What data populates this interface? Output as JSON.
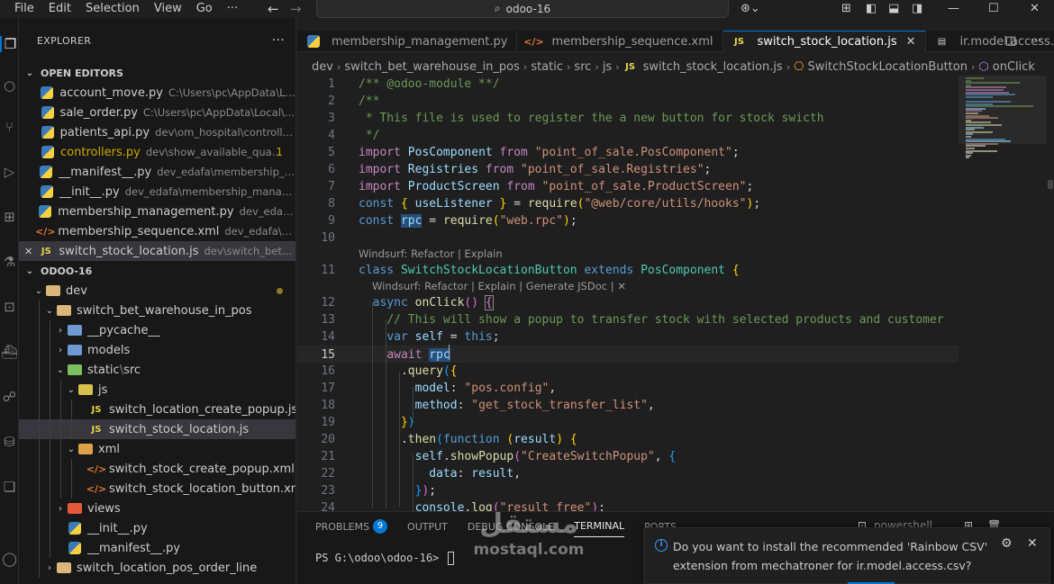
{
  "menu": [
    "File",
    "Edit",
    "Selection",
    "View",
    "Go",
    "···"
  ],
  "command_center": {
    "text": "odoo-16"
  },
  "explorer": {
    "title": "EXPLORER",
    "more": "···",
    "open_editors": {
      "title": "OPEN EDITORS",
      "items": [
        {
          "close": "",
          "icon": "python-file-icon",
          "name": "account_move.py",
          "desc": "C:\\Users\\pc\\AppData\\Lo..."
        },
        {
          "close": "",
          "icon": "python-file-icon",
          "name": "sale_order.py",
          "desc": "C:\\Users\\pc\\AppData\\Local\\T..."
        },
        {
          "close": "",
          "icon": "python-file-icon",
          "name": "patients_api.py",
          "desc": "dev\\om_hospital\\controllers"
        },
        {
          "close": "",
          "icon": "python-file-icon",
          "name": "controllers.py",
          "desc": "dev\\show_available_qua...",
          "badge": "1"
        },
        {
          "close": "",
          "icon": "python-file-icon",
          "name": "__manifest__.py",
          "desc": "dev_edafa\\membership_ma..."
        },
        {
          "close": "",
          "icon": "python-file-icon",
          "name": "__init__.py",
          "desc": "dev_edafa\\membership_manage..."
        },
        {
          "close": "",
          "icon": "python-file-icon",
          "name": "membership_management.py",
          "desc": "dev_edafa\\..."
        },
        {
          "close": "",
          "icon": "xml-file-icon",
          "name": "membership_sequence.xml",
          "desc": "dev_edafa\\me..."
        },
        {
          "close": "✕",
          "icon": "js-file-icon",
          "name": "switch_stock_location.js",
          "desc": "dev\\switch_bet_w..."
        }
      ]
    },
    "workspace": {
      "title": "ODOO-16",
      "tree": [
        {
          "depth": 1,
          "chev": "⌄",
          "icon": "folder",
          "name": "dev",
          "dot": true
        },
        {
          "depth": 2,
          "chev": "⌄",
          "icon": "folder",
          "name": "switch_bet_warehouse_in_pos"
        },
        {
          "depth": 3,
          "chev": "›",
          "icon": "folder-blue",
          "name": "__pycache__"
        },
        {
          "depth": 3,
          "chev": "›",
          "icon": "folder-blue",
          "name": "models"
        },
        {
          "depth": 3,
          "chev": "⌄",
          "icon": "folder-green",
          "name": "static",
          "name2": "src"
        },
        {
          "depth": 4,
          "chev": "⌄",
          "icon": "folder-js",
          "name": "js"
        },
        {
          "depth": 5,
          "chev": "",
          "icon": "js",
          "name": "switch_location_create_popup.js"
        },
        {
          "depth": 5,
          "chev": "",
          "icon": "js",
          "name": "switch_stock_location.js",
          "selected": true
        },
        {
          "depth": 4,
          "chev": "⌄",
          "icon": "folder-xml",
          "name": "xml"
        },
        {
          "depth": 5,
          "chev": "",
          "icon": "xml",
          "name": "switch_stock_create_popup.xml"
        },
        {
          "depth": 5,
          "chev": "",
          "icon": "xml",
          "name": "switch_stock_location_button.xml"
        },
        {
          "depth": 3,
          "chev": "›",
          "icon": "folder-views",
          "name": "views"
        },
        {
          "depth": 3,
          "chev": "",
          "icon": "python",
          "name": "__init__.py"
        },
        {
          "depth": 3,
          "chev": "",
          "icon": "python",
          "name": "__manifest__.py"
        },
        {
          "depth": 2,
          "chev": "›",
          "icon": "folder",
          "name": "switch_location_pos_order_line"
        }
      ]
    }
  },
  "tabs": [
    {
      "icon": "python-file-icon",
      "glyph": "",
      "label": "membership_management.py",
      "active": false
    },
    {
      "icon": "xml-file-icon",
      "glyph": "</>",
      "label": "membership_sequence.xml",
      "active": false
    },
    {
      "icon": "js-file-icon",
      "glyph": "JS",
      "label": "switch_stock_location.js",
      "active": true,
      "close": "✕"
    },
    {
      "icon": "csv-file-icon",
      "glyph": "",
      "label": "ir.model.access.csv",
      "desc": "...\\",
      "active": false
    }
  ],
  "breadcrumb": [
    "dev",
    "switch_bet_warehouse_in_pos",
    "static",
    "src",
    "js",
    "switch_stock_location.js",
    "SwitchStockLocationButton",
    "onClick"
  ],
  "code": {
    "current_line": 15,
    "lines": [
      {
        "n": "1",
        "tokens": [
          [
            "t-com",
            "/** @odoo-module **/"
          ]
        ]
      },
      {
        "n": "2",
        "tokens": [
          [
            "t-com",
            "/**"
          ]
        ]
      },
      {
        "n": "3",
        "tokens": [
          [
            "t-com",
            " * This file is used to register the a new button for stock swicth"
          ]
        ]
      },
      {
        "n": "4",
        "tokens": [
          [
            "t-com",
            " */"
          ]
        ]
      },
      {
        "n": "5",
        "tokens": [
          [
            "t-kw",
            "import "
          ],
          [
            "t-var",
            "PosComponent "
          ],
          [
            "t-kw",
            "from "
          ],
          [
            "t-str",
            "\"point_of_sale.PosComponent\""
          ],
          [
            "t-pun",
            ";"
          ]
        ]
      },
      {
        "n": "6",
        "tokens": [
          [
            "t-kw",
            "import "
          ],
          [
            "t-var",
            "Registries "
          ],
          [
            "t-kw",
            "from "
          ],
          [
            "t-str",
            "\"point_of_sale.Registries\""
          ],
          [
            "t-pun",
            ";"
          ]
        ]
      },
      {
        "n": "7",
        "tokens": [
          [
            "t-kw",
            "import "
          ],
          [
            "t-var",
            "ProductScreen "
          ],
          [
            "t-kw",
            "from "
          ],
          [
            "t-str",
            "\"point_of_sale.ProductScreen\""
          ],
          [
            "t-pun",
            ";"
          ]
        ]
      },
      {
        "n": "8",
        "tokens": [
          [
            "t-kw2",
            "const "
          ],
          [
            "t-br",
            "{ "
          ],
          [
            "t-var",
            "useListener "
          ],
          [
            "t-br",
            "}"
          ],
          [
            "t-pun",
            " = "
          ],
          [
            "t-fn",
            "require"
          ],
          [
            "t-br",
            "("
          ],
          [
            "t-str",
            "\"@web/core/utils/hooks\""
          ],
          [
            "t-br",
            ")"
          ],
          [
            "t-pun",
            ";"
          ]
        ]
      },
      {
        "n": "9",
        "tokens": [
          [
            "t-kw2",
            "const "
          ],
          [
            "t-var hl-word",
            "rpc"
          ],
          [
            "t-pun",
            " = "
          ],
          [
            "t-fn",
            "require"
          ],
          [
            "t-br",
            "("
          ],
          [
            "t-str",
            "\"web.rpc\""
          ],
          [
            "t-br",
            ")"
          ],
          [
            "t-pun",
            ";"
          ]
        ]
      },
      {
        "n": "10",
        "tokens": []
      },
      {
        "lens": "Windsurf: Refactor | Explain"
      },
      {
        "n": "11",
        "tokens": [
          [
            "t-kw2",
            "class "
          ],
          [
            "t-cls",
            "SwitchStockLocationButton "
          ],
          [
            "t-kw2",
            "extends "
          ],
          [
            "t-cls",
            "PosComponent "
          ],
          [
            "t-br",
            "{"
          ]
        ]
      },
      {
        "lens": "Windsurf: Refactor | Explain | Generate JSDoc | ✕",
        "indent": 1
      },
      {
        "n": "12",
        "tokens": [
          [
            "t-pun",
            "  "
          ],
          [
            "t-kw2",
            "async "
          ],
          [
            "t-fn",
            "onClick"
          ],
          [
            "t-br2",
            "()"
          ],
          [
            "t-pun",
            " "
          ],
          [
            "t-br2 box-br",
            "{"
          ]
        ]
      },
      {
        "n": "13",
        "tokens": [
          [
            "t-pun",
            "    "
          ],
          [
            "t-com",
            "// This will show a popup to transfer stock with selected products and customer"
          ]
        ]
      },
      {
        "n": "14",
        "tokens": [
          [
            "t-pun",
            "    "
          ],
          [
            "t-kw2",
            "var "
          ],
          [
            "t-var",
            "self"
          ],
          [
            "t-pun",
            " = "
          ],
          [
            "t-kw2",
            "this"
          ],
          [
            "t-pun",
            ";"
          ]
        ]
      },
      {
        "n": "15",
        "tokens": [
          [
            "t-pun",
            "    "
          ],
          [
            "t-kw",
            "await "
          ],
          [
            "t-var hl-word",
            "rpc"
          ]
        ]
      },
      {
        "n": "16",
        "tokens": [
          [
            "t-pun",
            "      ."
          ],
          [
            "t-fn",
            "query"
          ],
          [
            "t-br3",
            "("
          ],
          [
            "t-br",
            "{"
          ]
        ]
      },
      {
        "n": "17",
        "tokens": [
          [
            "t-pun",
            "        "
          ],
          [
            "t-var",
            "model"
          ],
          [
            "t-pun",
            ": "
          ],
          [
            "t-str",
            "\"pos.config\""
          ],
          [
            "t-pun",
            ","
          ]
        ]
      },
      {
        "n": "18",
        "tokens": [
          [
            "t-pun",
            "        "
          ],
          [
            "t-var",
            "method"
          ],
          [
            "t-pun",
            ": "
          ],
          [
            "t-str",
            "\"get_stock_transfer_list\""
          ],
          [
            "t-pun",
            ","
          ]
        ]
      },
      {
        "n": "19",
        "tokens": [
          [
            "t-pun",
            "      "
          ],
          [
            "t-br",
            "}"
          ],
          [
            "t-br3",
            ")"
          ]
        ]
      },
      {
        "n": "20",
        "tokens": [
          [
            "t-pun",
            "      ."
          ],
          [
            "t-fn",
            "then"
          ],
          [
            "t-br3",
            "("
          ],
          [
            "t-kw2",
            "function "
          ],
          [
            "t-br",
            "("
          ],
          [
            "t-var",
            "result"
          ],
          [
            "t-br",
            ")"
          ],
          [
            "t-pun",
            " "
          ],
          [
            "t-br",
            "{"
          ]
        ]
      },
      {
        "n": "21",
        "tokens": [
          [
            "t-pun",
            "        "
          ],
          [
            "t-var",
            "self"
          ],
          [
            "t-pun",
            "."
          ],
          [
            "t-fn",
            "showPopup"
          ],
          [
            "t-br2",
            "("
          ],
          [
            "t-str",
            "\"CreateSwitchPopup\""
          ],
          [
            "t-pun",
            ", "
          ],
          [
            "t-br3",
            "{"
          ]
        ]
      },
      {
        "n": "22",
        "tokens": [
          [
            "t-pun",
            "          "
          ],
          [
            "t-var",
            "data"
          ],
          [
            "t-pun",
            ": "
          ],
          [
            "t-var",
            "result"
          ],
          [
            "t-pun",
            ","
          ]
        ]
      },
      {
        "n": "23",
        "tokens": [
          [
            "t-pun",
            "        "
          ],
          [
            "t-br3",
            "}"
          ],
          [
            "t-br2",
            ")"
          ],
          [
            "t-pun",
            ";"
          ]
        ]
      },
      {
        "n": "24",
        "tokens": [
          [
            "t-pun",
            "        "
          ],
          [
            "t-var",
            "console"
          ],
          [
            "t-pun",
            "."
          ],
          [
            "t-fn",
            "log"
          ],
          [
            "t-br2",
            "("
          ],
          [
            "t-str",
            "\"result free\""
          ],
          [
            "t-br2",
            ")"
          ],
          [
            "t-pun",
            ";"
          ]
        ]
      }
    ]
  },
  "panel": {
    "tabs": [
      {
        "label": "PROBLEMS",
        "badge": "9"
      },
      {
        "label": "OUTPUT"
      },
      {
        "label": "DEBUG CONSOLE"
      },
      {
        "label": "TERMINAL",
        "active": true
      },
      {
        "label": "PORTS"
      }
    ],
    "terminal_label": "powershell",
    "terminal_prompt": "PS G:\\odoo\\odoo-16> "
  },
  "notification": {
    "icon": "i",
    "text": "Do you want to install the recommended 'Rainbow CSV' extension from mechatroner for ir.model.access.csv?",
    "gear": "⚙",
    "close": "✕"
  },
  "watermark": {
    "arabic": "مستقل",
    "latin": "mostaql.com"
  }
}
